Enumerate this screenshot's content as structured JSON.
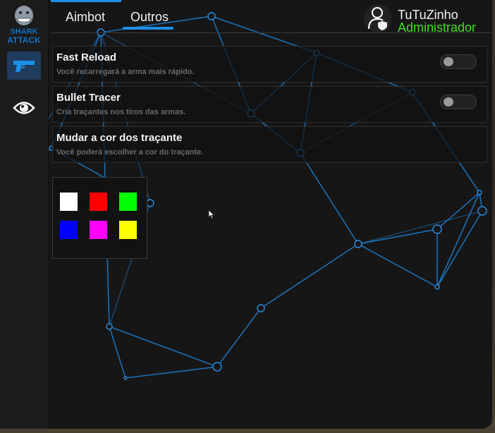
{
  "logo": {
    "text_top": "SHARK",
    "text_bottom": "ATTACK"
  },
  "sidebar": {
    "items": [
      {
        "icon": "gun-icon",
        "active": true
      },
      {
        "icon": "eye-icon",
        "active": false
      }
    ]
  },
  "tabs": [
    {
      "label": "Aimbot",
      "active": false
    },
    {
      "label": "Outros",
      "active": true
    }
  ],
  "user": {
    "name": "TuTuZinho",
    "role": "Administrador",
    "role_color": "#3ee01f",
    "icon": "user-shield-icon"
  },
  "options": [
    {
      "title": "Fast Reload",
      "description": "Você recarregará a arma mais rápido.",
      "enabled": false
    },
    {
      "title": "Bullet Tracer",
      "description": "Cria traçantes nos tiros das armas.",
      "enabled": false
    },
    {
      "title": "Mudar a cor dos traçante",
      "description": "Você poderá escolher a cor do traçante."
    }
  ],
  "color_picker": {
    "colors": [
      "#ffffff",
      "#ff0000",
      "#00ff00",
      "#0000ff",
      "#ff00ff",
      "#ffff00"
    ]
  },
  "theme": {
    "accent": "#1e8fe6",
    "panel_bg": "#161616"
  }
}
